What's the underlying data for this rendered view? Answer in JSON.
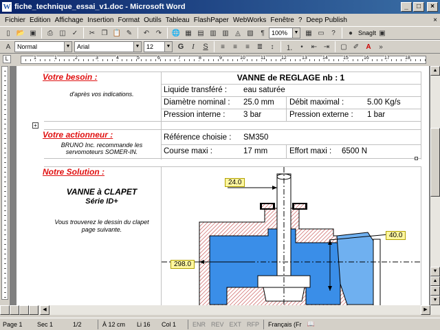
{
  "window": {
    "title": "fiche_technique_essai_v1.doc - Microsoft Word",
    "app_icon": "word-icon"
  },
  "menu": {
    "items": [
      "Fichier",
      "Edition",
      "Affichage",
      "Insertion",
      "Format",
      "Outils",
      "Tableau",
      "FlashPaper",
      "WebWorks",
      "Fenêtre",
      "?",
      "Deep Publish"
    ]
  },
  "toolbar": {
    "zoom": "100%",
    "snagit_label": "SnagIt",
    "style": "Normal",
    "font": "Arial",
    "size": "12",
    "bold_label": "G",
    "italic_label": "I",
    "underline_label": "S"
  },
  "ruler": {
    "corner": "L",
    "numbers": [
      "1",
      "1",
      "2",
      "3",
      "4",
      "5",
      "6",
      "7",
      "8",
      "9",
      "10",
      "11",
      "12",
      "13",
      "14",
      "15",
      "16",
      "17",
      "18"
    ]
  },
  "document": {
    "besoin": {
      "heading": "Votre besoin :",
      "note": "d'après vos indications.",
      "title": "VANNE de REGLAGE  nb :  1",
      "rows": [
        {
          "label": "Liquide transféré :",
          "value": "eau saturée"
        },
        {
          "label": "Diamètre nominal :",
          "value": "25.0 mm",
          "label2": "Débit maximal :",
          "value2": "5.00 Kg/s"
        },
        {
          "label": "Pression interne :",
          "value": "3 bar",
          "label2": "Pression externe :",
          "value2": "1 bar"
        }
      ]
    },
    "actionneur": {
      "heading": "Votre actionneur :",
      "note_line1": "BRUNO Inc. recommande les",
      "note_line2": "servomoteurs SOMER-IN.",
      "rows": [
        {
          "label": "Référence choisie :",
          "value": "SM350"
        },
        {
          "label": "Course maxi :",
          "value": "17 mm",
          "label2": "Effort maxi :",
          "value2": "6500 N"
        }
      ]
    },
    "solution": {
      "heading": "Notre Solution  :",
      "product": "VANNE à CLAPET",
      "series": "Série ID+",
      "note_line1": "Vous trouverez le dessin du clapet",
      "note_line2": "page suivante.",
      "dims": [
        "24.0",
        "40.0",
        "298.0"
      ]
    }
  },
  "status": {
    "page": "Page  1",
    "section": "Sec  1",
    "pages": "1/2",
    "at": "À  12 cm",
    "line": "Li  16",
    "col": "Col  1",
    "enr": "ENR",
    "rev": "REV",
    "ext": "EXT",
    "rfp": "RFP",
    "lang": "Français (Fr"
  },
  "colors": {
    "title_gradient_start": "#0a246a",
    "title_gradient_end": "#3a6ea5",
    "heading_red": "#e01010",
    "valve_blue": "#3a8ee8",
    "hatch": "#c04040",
    "dim_label_bg": "#fff7a0"
  }
}
